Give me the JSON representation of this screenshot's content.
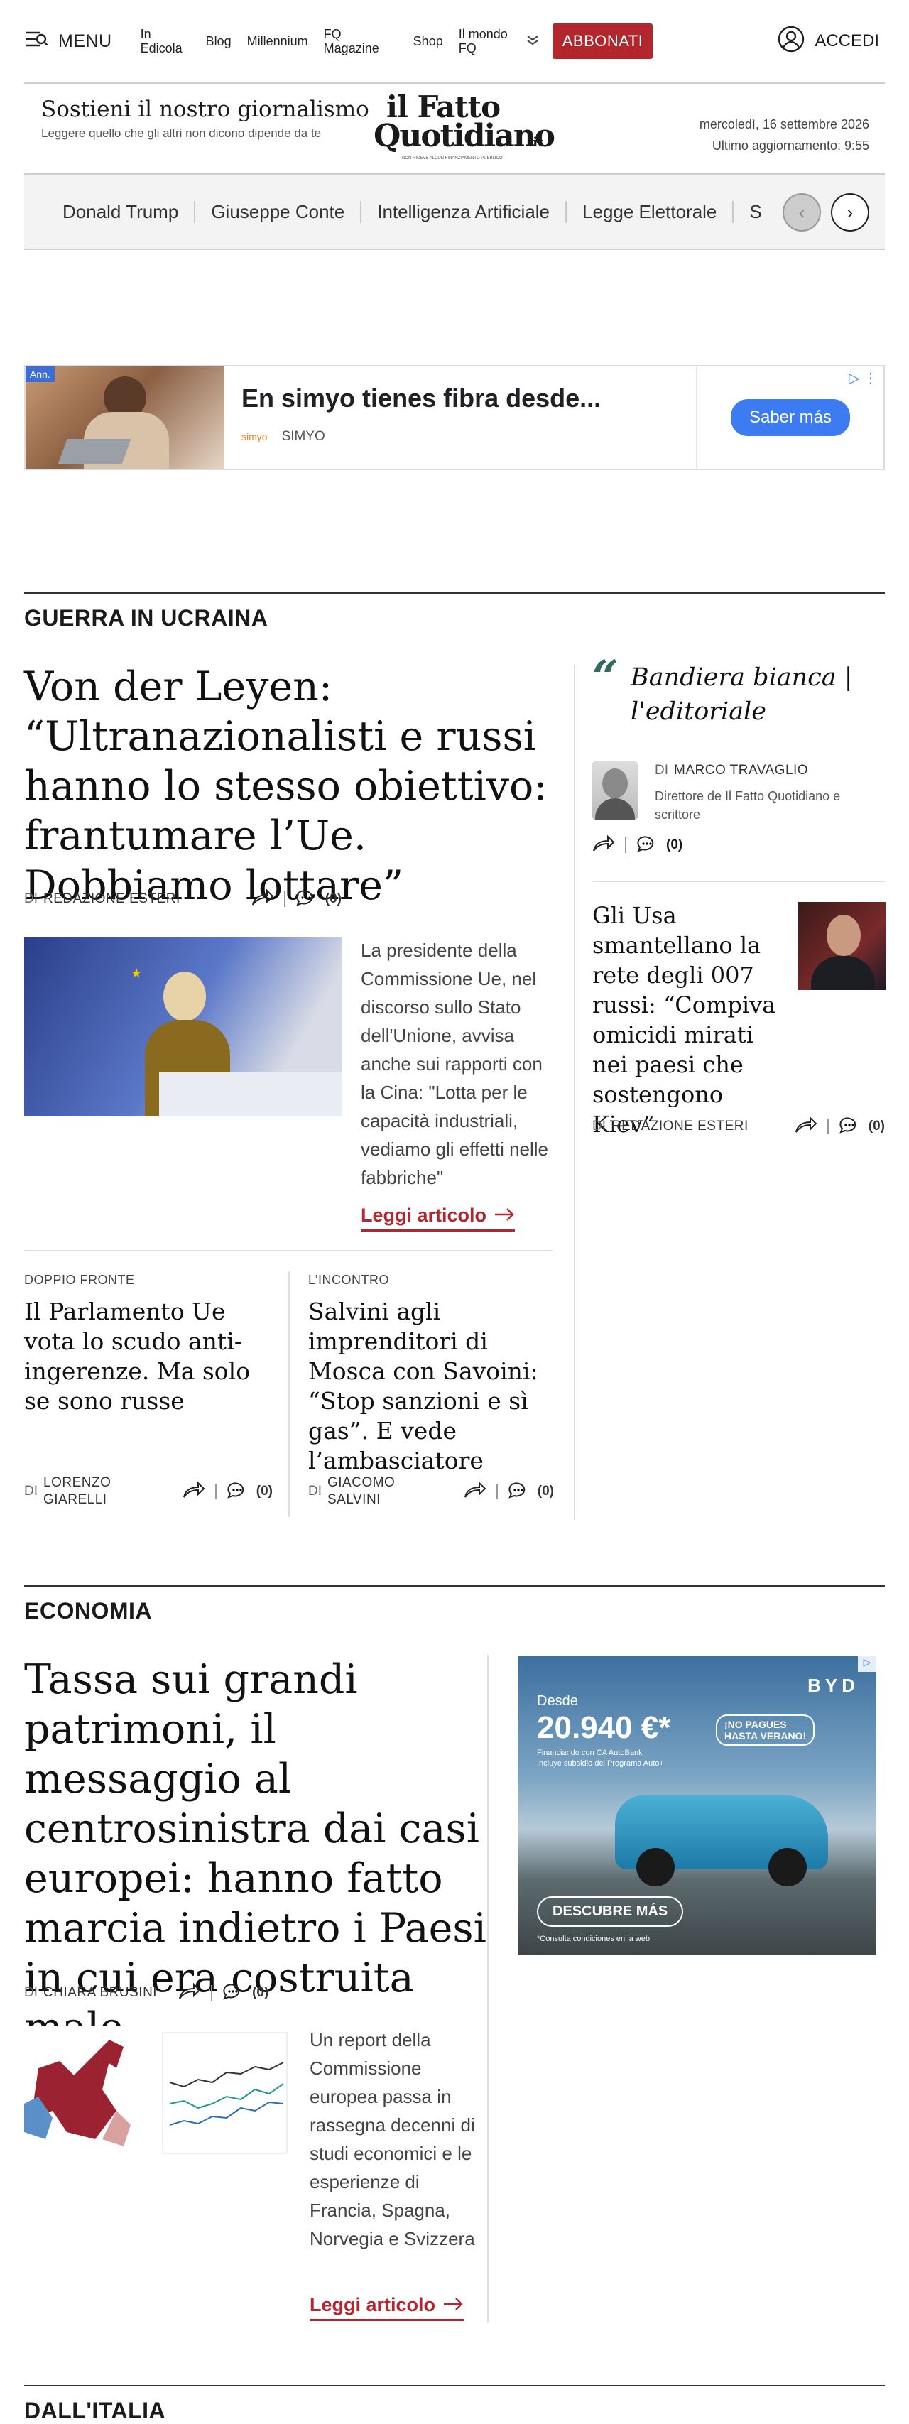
{
  "header": {
    "menu_label": "MENU",
    "nav": [
      "In Edicola",
      "Blog",
      "Millennium",
      "FQ Magazine",
      "Shop",
      "Il mondo FQ"
    ],
    "subscribe": "ABBONATI",
    "login": "ACCEDI"
  },
  "masthead": {
    "slogan": "Sostieni il nostro giornalismo",
    "slogan_sub": "Leggere quello che gli altri non dicono dipende da te",
    "logo_line1": "il Fatto",
    "logo_line2": "Quotidiano",
    "logo_suffix": ".it",
    "logo_tagline": "NON RICEVE ALCUN FINANZIAMENTO PUBBLICO",
    "date": "mercoledì, 16 settembre 2026",
    "updated": "Ultimo aggiornamento: 9:55"
  },
  "topics": [
    "Donald Trump",
    "Giuseppe Conte",
    "Intelligenza Artificiale",
    "Legge Elettorale",
    "S"
  ],
  "ad": {
    "tag": "Ann.",
    "title": "En simyo tienes fibra desde...",
    "brand_logo": "simyo",
    "brand": "SIMYO",
    "cta": "Saber más"
  },
  "section1": {
    "title": "GUERRA IN UCRAINA",
    "main": {
      "title": "Von der Leyen: “Ultranazionalisti e russi hanno lo stesso obiettivo: frantumare l’Ue. Dobbiamo lottare”",
      "di": "DI",
      "author": "REDAZIONE ESTERI",
      "comments": "(0)",
      "desc": "La presidente della Commissione Ue, nel discorso sullo Stato dell'Unione, avvisa anche sui rapporti con la Cina: \"Lotta per le capacità industriali, vediamo gli effetti nelle fabbriche\"",
      "read": "Leggi articolo"
    },
    "sub1": {
      "kicker": "DOPPIO FRONTE",
      "title": "Il Parlamento Ue vota lo scudo anti-ingerenze. Ma solo se sono russe",
      "di": "DI",
      "author": "LORENZO GIARELLI",
      "comments": "(0)"
    },
    "sub2": {
      "kicker": "L’INCONTRO",
      "title": "Salvini agli imprenditori di Mosca con Savoini: “Stop sanzioni e sì gas”. E vede l’ambasciatore",
      "di": "DI",
      "author": "GIACOMO SALVINI",
      "comments": "(0)"
    },
    "editorial": {
      "title": "Bandiera bianca | l'editoriale",
      "di": "DI",
      "author": "MARCO TRAVAGLIO",
      "role": "Direttore de Il Fatto Quotidiano e scrittore",
      "comments": "(0)"
    },
    "side": {
      "title": "Gli Usa smantellano la rete degli 007 russi: “Compiva omicidi mirati nei paesi che sostengono Kiev”",
      "di": "DI",
      "author": "REDAZIONE ESTERI",
      "comments": "(0)"
    }
  },
  "section2": {
    "title": "ECONOMIA",
    "main": {
      "title": "Tassa sui grandi patrimoni, il messaggio al centrosinistra dai casi europei: hanno fatto marcia indietro i Paesi in cui era costruita male",
      "di": "DI",
      "author": "CHIARA BRUSINI",
      "comments": "(0)",
      "desc": "Un report della Commissione europea passa in rassegna decenni di studi economici e le esperienze di Francia, Spagna, Norvegia e Svizzera",
      "read": "Leggi articolo"
    },
    "ad": {
      "brand": "BYD",
      "from": "Desde",
      "price": "20.940 €*",
      "badge1": "¡NO PAGUES",
      "badge2": "HASTA VERANO!",
      "small": "Financiando con CA AutoBank",
      "small2": "Incluye subsidio del Programa Auto+",
      "cta": "DESCUBRE MÁS",
      "note": "*Consulta condiciones en la web"
    }
  },
  "section3": {
    "title": "DALL'ITALIA"
  }
}
